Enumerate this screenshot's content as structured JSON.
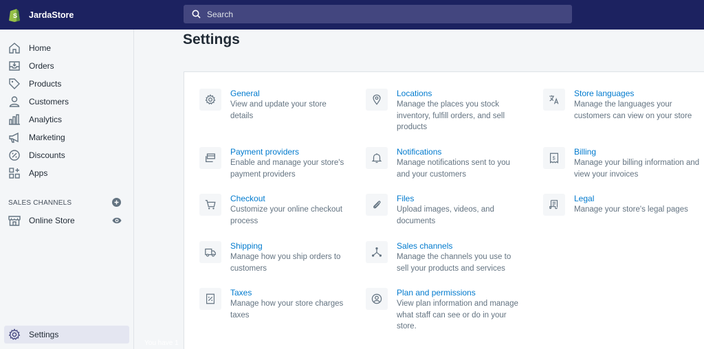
{
  "app": {
    "store_name": "JardaStore",
    "accent_color": "#1c2260",
    "link_color": "#007ace"
  },
  "search": {
    "placeholder": "Search"
  },
  "sidebar": {
    "items": [
      {
        "label": "Home",
        "icon": "home-icon"
      },
      {
        "label": "Orders",
        "icon": "orders-icon"
      },
      {
        "label": "Products",
        "icon": "tag-icon"
      },
      {
        "label": "Customers",
        "icon": "person-icon"
      },
      {
        "label": "Analytics",
        "icon": "bar-chart-icon"
      },
      {
        "label": "Marketing",
        "icon": "megaphone-icon"
      },
      {
        "label": "Discounts",
        "icon": "discount-icon"
      },
      {
        "label": "Apps",
        "icon": "apps-icon"
      }
    ],
    "sales_channels_heading": "SALES CHANNELS",
    "channels": [
      {
        "label": "Online Store",
        "icon": "store-icon"
      }
    ],
    "settings_label": "Settings"
  },
  "page": {
    "title": "Settings"
  },
  "settings": [
    {
      "title": "General",
      "desc": "View and update your store details",
      "icon": "gear-icon"
    },
    {
      "title": "Locations",
      "desc": "Manage the places you stock inventory, fulfill orders, and sell products",
      "icon": "location-pin-icon"
    },
    {
      "title": "Store languages",
      "desc": "Manage the languages your customers can view on your store",
      "icon": "translate-icon"
    },
    {
      "title": "Payment providers",
      "desc": "Enable and manage your store's payment providers",
      "icon": "payment-icon"
    },
    {
      "title": "Notifications",
      "desc": "Manage notifications sent to you and your customers",
      "icon": "bell-icon"
    },
    {
      "title": "Billing",
      "desc": "Manage your billing information and view your invoices",
      "icon": "invoice-icon"
    },
    {
      "title": "Checkout",
      "desc": "Customize your online checkout process",
      "icon": "cart-icon"
    },
    {
      "title": "Files",
      "desc": "Upload images, videos, and documents",
      "icon": "paperclip-icon"
    },
    {
      "title": "Legal",
      "desc": "Manage your store's legal pages",
      "icon": "legal-document-icon"
    },
    {
      "title": "Shipping",
      "desc": "Manage how you ship orders to customers",
      "icon": "truck-icon"
    },
    {
      "title": "Sales channels",
      "desc": "Manage the channels you use to sell your products and services",
      "icon": "channels-icon"
    },
    {
      "title": "Taxes",
      "desc": "Manage how your store charges taxes",
      "icon": "tax-icon"
    },
    {
      "title": "Plan and permissions",
      "desc": "View plan information and manage what staff can see or do in your store.",
      "icon": "user-circle-icon"
    }
  ],
  "footer": {
    "partial_text": "You have 1"
  }
}
